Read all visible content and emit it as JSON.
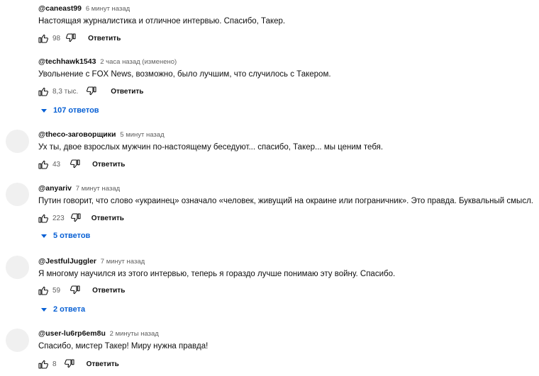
{
  "comments": [
    {
      "author": "@caneast99",
      "time": "6 минут назад",
      "text": "Настоящая журналистика и отличное интервью. Спасибо, Такер.",
      "likes": "98",
      "reply_label": "Ответить",
      "avatar_visible": false
    },
    {
      "author": "@techhawk1543",
      "time": "2 часа назад (изменено)",
      "text": "Увольнение с FOX News, возможно, было лучшим, что случилось с Такером.",
      "likes": "8,3 тыс.",
      "reply_label": "Ответить",
      "replies_label": "107 ответов",
      "avatar_visible": false
    },
    {
      "author": "@theco-заговорщики",
      "time": "5 минут назад",
      "text": "Ух ты, двое взрослых мужчин по-настоящему беседуют... спасибо, Такер... мы ценим тебя.",
      "likes": "43",
      "reply_label": "Ответить",
      "avatar_visible": true
    },
    {
      "author": "@anyariv",
      "time": "7 минут назад",
      "text": "Путин говорит, что слово «украинец» означало «человек, живущий на окраине или пограничник». Это правда. Буквальный смысл.",
      "likes": "223",
      "reply_label": "Ответить",
      "replies_label": "5 ответов",
      "avatar_visible": true
    },
    {
      "author": "@JestfulJuggler",
      "time": "7 минут назад",
      "text": "Я многому научился из этого интервью, теперь я гораздо лучше понимаю эту войну. Спасибо.",
      "likes": "59",
      "reply_label": "Ответить",
      "replies_label": "2 ответа",
      "avatar_visible": true
    },
    {
      "author": "@user-lu6rp6em8u",
      "time": "2 минуты назад",
      "text": "Спасибо, мистер Такер! Миру нужна правда!",
      "likes": "8",
      "reply_label": "Ответить",
      "avatar_visible": true
    }
  ],
  "icons": {
    "like": "thumb-up-icon",
    "dislike": "thumb-down-icon",
    "expand": "caret-down-icon"
  },
  "colors": {
    "link_blue": "#065fd4",
    "secondary_text": "#606060",
    "avatar_placeholder": "#f0f0f0"
  }
}
